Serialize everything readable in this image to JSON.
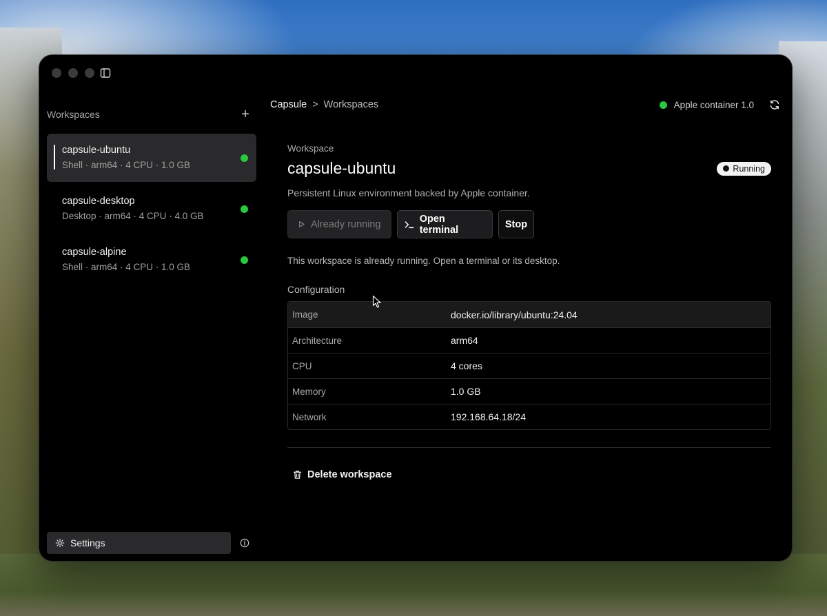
{
  "sidebar": {
    "title": "Workspaces",
    "add_label": "+",
    "items": [
      {
        "name": "capsule-ubuntu",
        "meta": "Shell · arm64 · 4 CPU · 1.0 GB",
        "status": "running",
        "active": true
      },
      {
        "name": "capsule-desktop",
        "meta": "Desktop · arm64 · 4 CPU · 4.0 GB",
        "status": "running",
        "active": false
      },
      {
        "name": "capsule-alpine",
        "meta": "Shell · arm64 · 4 CPU · 1.0 GB",
        "status": "running",
        "active": false
      }
    ],
    "settings_label": "Settings"
  },
  "topbar": {
    "breadcrumb": [
      "Capsule",
      "Workspaces"
    ],
    "breadcrumb_sep": ">",
    "runtime_label": "Apple container 1.0"
  },
  "workspace": {
    "kicker": "Workspace",
    "title": "capsule-ubuntu",
    "status_badge": "Running",
    "description": "Persistent Linux environment backed by Apple container.",
    "actions": {
      "already_running": "Already running",
      "open_terminal": "Open terminal",
      "stop": "Stop"
    },
    "hint": "This workspace is already running. Open a terminal or its desktop.",
    "config_label": "Configuration",
    "config": [
      {
        "key": "Image",
        "value": "docker.io/library/ubuntu:24.04"
      },
      {
        "key": "Architecture",
        "value": "arm64"
      },
      {
        "key": "CPU",
        "value": "4 cores"
      },
      {
        "key": "Memory",
        "value": "1.0 GB"
      },
      {
        "key": "Network",
        "value": "192.168.64.18/24"
      }
    ],
    "delete_label": "Delete workspace"
  },
  "colors": {
    "status_green": "#28c840",
    "window_bg": "#000000",
    "active_item_bg": "#2a2a2c"
  }
}
